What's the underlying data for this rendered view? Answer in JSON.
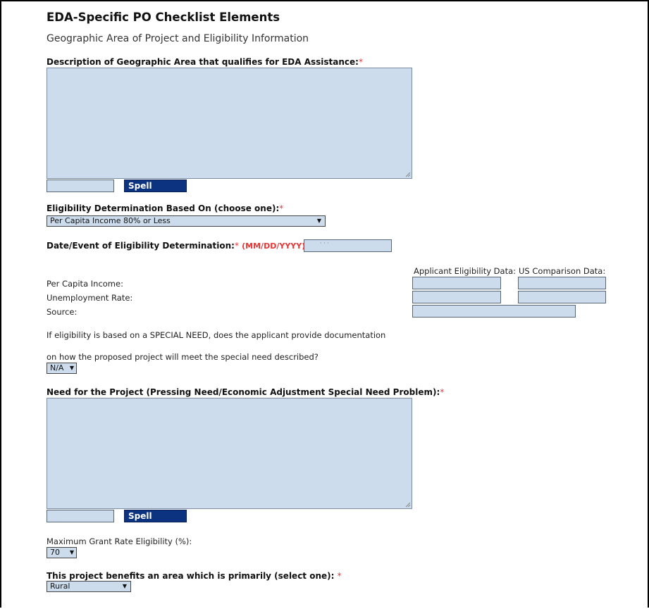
{
  "page": {
    "title": "EDA-Specific PO Checklist Elements",
    "section": "Geographic Area of Project and Eligibility Information"
  },
  "geo_area": {
    "label": "Description of Geographic Area that qualifies for EDA Assistance:",
    "required": "*",
    "value": "",
    "spell_value": "",
    "spell_check": "Spell Check"
  },
  "eligibility": {
    "label": "Eligibility Determination Based On (choose one):",
    "required": "*",
    "selected": "Per Capita Income 80% or Less"
  },
  "date_event": {
    "label": "Date/Event of Eligibility Determination:",
    "required": "*",
    "format": "(MM/DD/YYYY)",
    "value": "· · ·"
  },
  "data_table": {
    "col_applicant": "Applicant Eligibility Data:",
    "col_us": "US Comparison Data:",
    "row_income": "Per Capita Income:",
    "row_unemployment": "Unemployment Rate:",
    "row_source": "Source:"
  },
  "special_need": {
    "line1": "If eligibility is based on a SPECIAL NEED, does the applicant provide documentation",
    "line2": "on how the proposed project will meet the special need described?",
    "selected": "N/A"
  },
  "need": {
    "label": "Need for the Project (Pressing Need/Economic Adjustment Special Need Problem):",
    "required": "*",
    "value": "",
    "spell_value": "",
    "spell_check": "Spell Check"
  },
  "grant_rate": {
    "label": "Maximum Grant Rate Eligibility (%):",
    "selected": "70"
  },
  "area_type": {
    "label": "This project benefits an area which is primarily (select one):",
    "required": "*",
    "selected": "Rural"
  },
  "icons": {
    "dropdown": "dropdown-arrow-icon",
    "resize": "resize-grip-icon"
  }
}
